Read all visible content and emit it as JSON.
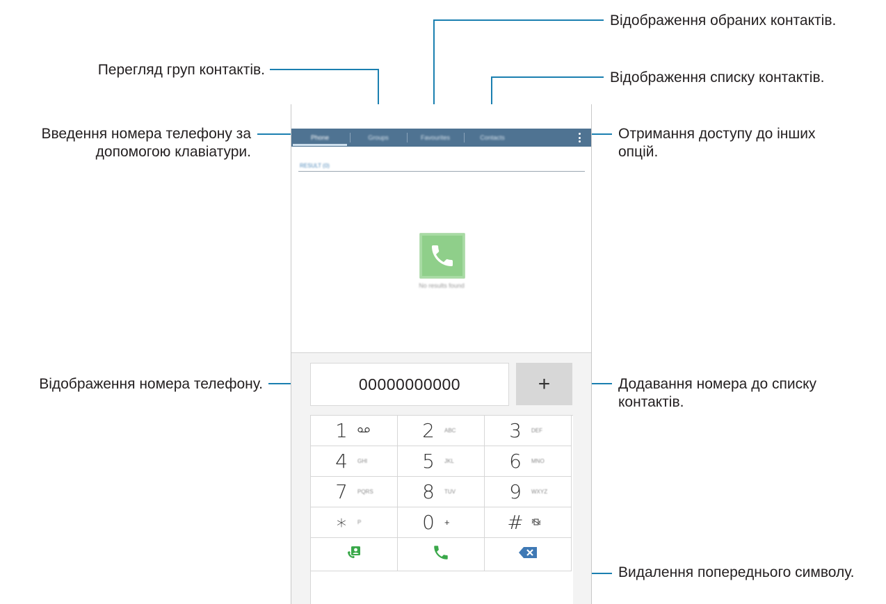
{
  "callouts": {
    "groups": "Перегляд груп контактів.",
    "favourites": "Відображення обраних контактів.",
    "contacts": "Відображення списку контактів.",
    "keypad": "Введення номера телефону за допомогою клавіатури.",
    "more_options": "Отримання доступу до інших опцій.",
    "number_display": "Відображення номера телефону.",
    "add_contact": "Додавання номера до списку контактів.",
    "delete": "Видалення попереднього символу."
  },
  "phone": {
    "tabs": [
      {
        "label": "Phone",
        "active": true
      },
      {
        "label": "Groups",
        "active": false
      },
      {
        "label": "Favourites",
        "active": false
      },
      {
        "label": "Contacts",
        "active": false
      }
    ],
    "section_label": "RESULT (0)",
    "empty_text": "No results found",
    "number": "00000000000",
    "add_label": "+",
    "keys": [
      {
        "digit": "1",
        "sub": "voicemail-icon"
      },
      {
        "digit": "2",
        "sub": "ABC"
      },
      {
        "digit": "3",
        "sub": "DEF"
      },
      {
        "digit": "4",
        "sub": "GHI"
      },
      {
        "digit": "5",
        "sub": "JKL"
      },
      {
        "digit": "6",
        "sub": "MNO"
      },
      {
        "digit": "7",
        "sub": "PQRS"
      },
      {
        "digit": "8",
        "sub": "TUV"
      },
      {
        "digit": "9",
        "sub": "WXYZ"
      },
      {
        "digit": "∗",
        "sub": "P"
      },
      {
        "digit": "0",
        "sub": "+"
      },
      {
        "digit": "#",
        "sub": "vibrate-off-icon"
      }
    ],
    "actions": [
      "video-contact-icon",
      "call-icon",
      "backspace-icon"
    ],
    "colors": {
      "tabbar": "#4f7392",
      "accent_line": "#1a7fb0",
      "call_green": "#3aa84a",
      "backspace_blue": "#3f79b5"
    }
  }
}
